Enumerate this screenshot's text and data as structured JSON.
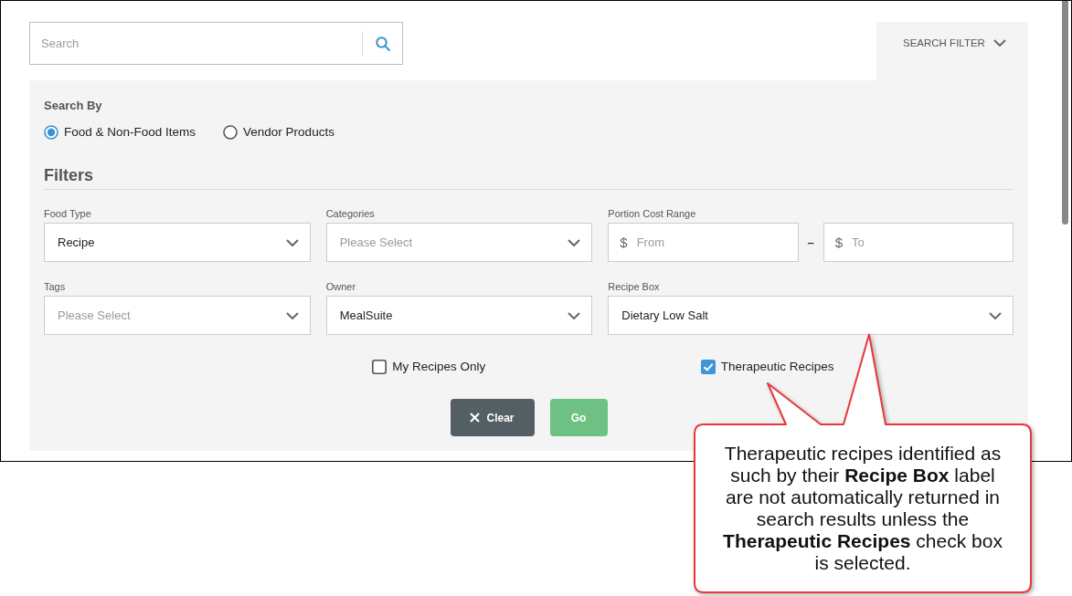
{
  "search": {
    "placeholder": "Search"
  },
  "filter_toggle": {
    "label": "SEARCH FILTER"
  },
  "search_by": {
    "title": "Search By",
    "options": [
      {
        "label": "Food & Non-Food Items",
        "selected": true
      },
      {
        "label": "Vendor Products",
        "selected": false
      }
    ]
  },
  "filters": {
    "title": "Filters",
    "fields": [
      {
        "kind": "select",
        "label": "Food Type",
        "value": "Recipe"
      },
      {
        "kind": "select",
        "label": "Categories",
        "placeholder": "Please Select"
      },
      {
        "kind": "range",
        "label": "Portion Cost Range",
        "from": {
          "prefix": "$",
          "placeholder": "From"
        },
        "separator": "–",
        "to": {
          "prefix": "$",
          "placeholder": "To"
        }
      },
      {
        "kind": "select",
        "label": "Tags",
        "placeholder": "Please Select"
      },
      {
        "kind": "select",
        "label": "Owner",
        "value": "MealSuite"
      },
      {
        "kind": "select",
        "label": "Recipe Box",
        "value": "Dietary Low Salt"
      }
    ],
    "checkboxes": [
      {
        "label": "My Recipes Only",
        "checked": false
      },
      {
        "label": "Therapeutic Recipes",
        "checked": true
      }
    ],
    "buttons": [
      {
        "kind": "clear",
        "label": "Clear"
      },
      {
        "kind": "go",
        "label": "Go"
      }
    ]
  },
  "callout": {
    "text": "Therapeutic recipes identified as such by their **Recipe Box** label are not automatically returned in search results unless the **Therapeutic Recipes** check box is selected."
  }
}
